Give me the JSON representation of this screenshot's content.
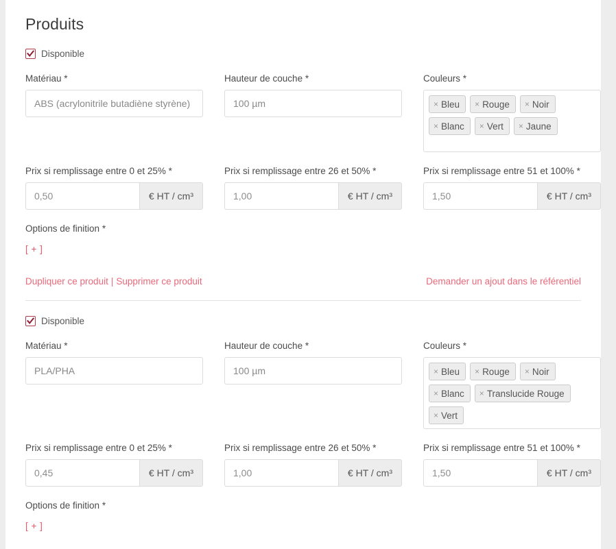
{
  "page": {
    "title": "Produits"
  },
  "labels": {
    "available": "Disponible",
    "material": "Matériau *",
    "layer_height": "Hauteur de couche *",
    "colors": "Couleurs *",
    "price_0_25": "Prix si remplissage entre 0 et 25% *",
    "price_26_50": "Prix si remplissage entre 26 et 50% *",
    "price_51_100": "Prix si remplissage entre 51 et 100% *",
    "finishing_options": "Options de finition *",
    "add_button": "[ + ]",
    "unit": "€ HT / cm³",
    "remove_tag_icon": "×",
    "check_icon": "checkmark-icon"
  },
  "links": {
    "duplicate": "Dupliquer ce produit",
    "separator": "|",
    "delete": "Supprimer ce produit",
    "request_referential": "Demander un ajout dans le référentiel"
  },
  "colors": {
    "accent_red": "#e8697a",
    "checkbox_border": "#b03a4a",
    "addon_bg": "#ededed",
    "tag_bg": "#ededed",
    "border": "#dcdcdc",
    "page_bg": "#ededed",
    "panel_bg": "#ffffff"
  },
  "products": [
    {
      "available": true,
      "material": "ABS (acrylonitrile butadiène styrène)",
      "layer_height": "100 µm",
      "colors": [
        "Bleu",
        "Rouge",
        "Noir",
        "Blanc",
        "Vert",
        "Jaune"
      ],
      "price_0_25": "0,50",
      "price_26_50": "1,00",
      "price_51_100": "1,50",
      "has_links_row": true
    },
    {
      "available": true,
      "material": "PLA/PHA",
      "layer_height": "100 µm",
      "colors": [
        "Bleu",
        "Rouge",
        "Noir",
        "Blanc",
        "Translucide Rouge",
        "Vert"
      ],
      "price_0_25": "0,45",
      "price_26_50": "1,00",
      "price_51_100": "1,50",
      "has_links_row": false
    }
  ]
}
